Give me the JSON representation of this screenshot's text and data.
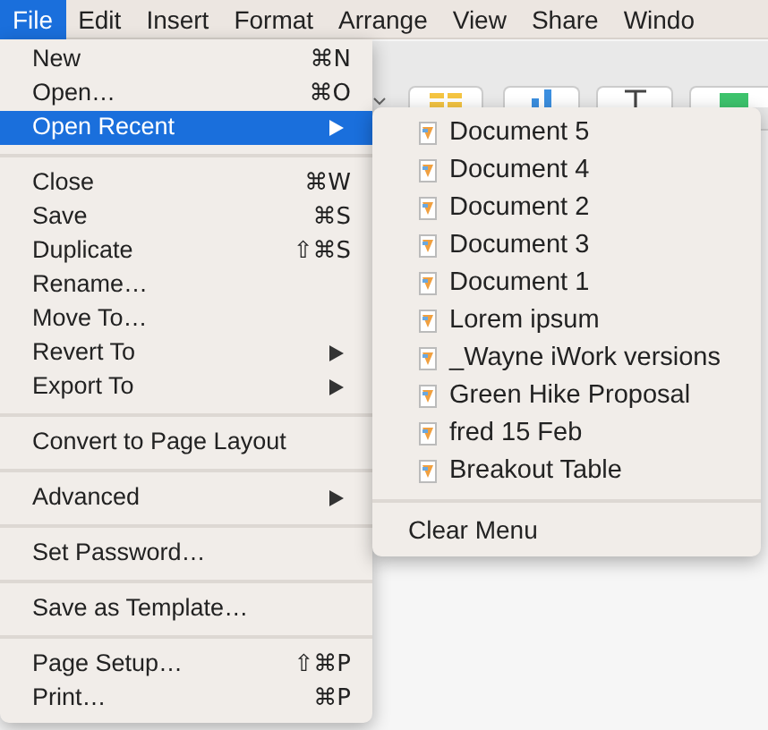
{
  "menubar": [
    {
      "label": "File",
      "selected": true
    },
    {
      "label": "Edit",
      "selected": false
    },
    {
      "label": "Insert",
      "selected": false
    },
    {
      "label": "Format",
      "selected": false
    },
    {
      "label": "Arrange",
      "selected": false
    },
    {
      "label": "View",
      "selected": false
    },
    {
      "label": "Share",
      "selected": false
    },
    {
      "label": "Windo",
      "selected": false
    }
  ],
  "file_menu": {
    "items": [
      {
        "kind": "item",
        "label": "New",
        "shortcut": "⌘N",
        "submenu": false,
        "selected": false
      },
      {
        "kind": "item",
        "label": "Open…",
        "shortcut": "⌘O",
        "submenu": false,
        "selected": false
      },
      {
        "kind": "item",
        "label": "Open Recent",
        "submenu": true,
        "selected": true
      },
      {
        "kind": "separator"
      },
      {
        "kind": "item",
        "label": "Close",
        "shortcut": "⌘W",
        "submenu": false,
        "selected": false
      },
      {
        "kind": "item",
        "label": "Save",
        "shortcut": "⌘S",
        "submenu": false,
        "selected": false
      },
      {
        "kind": "item",
        "label": "Duplicate",
        "shortcut": "⇧⌘S",
        "submenu": false,
        "selected": false
      },
      {
        "kind": "item",
        "label": "Rename…",
        "submenu": false,
        "selected": false
      },
      {
        "kind": "item",
        "label": "Move To…",
        "submenu": false,
        "selected": false
      },
      {
        "kind": "item",
        "label": "Revert To",
        "submenu": true,
        "selected": false
      },
      {
        "kind": "item",
        "label": "Export To",
        "submenu": true,
        "selected": false
      },
      {
        "kind": "separator"
      },
      {
        "kind": "item",
        "label": "Convert to Page Layout",
        "submenu": false,
        "selected": false
      },
      {
        "kind": "separator"
      },
      {
        "kind": "item",
        "label": "Advanced",
        "submenu": true,
        "selected": false
      },
      {
        "kind": "separator"
      },
      {
        "kind": "item",
        "label": "Set Password…",
        "submenu": false,
        "selected": false
      },
      {
        "kind": "separator"
      },
      {
        "kind": "item",
        "label": "Save as Template…",
        "submenu": false,
        "selected": false
      },
      {
        "kind": "separator"
      },
      {
        "kind": "item",
        "label": "Page Setup…",
        "shortcut": "⇧⌘P",
        "submenu": false,
        "selected": false
      },
      {
        "kind": "item",
        "label": "Print…",
        "shortcut": "⌘P",
        "submenu": false,
        "selected": false
      }
    ]
  },
  "open_recent_menu": {
    "items": [
      {
        "kind": "document",
        "label": "Document 5"
      },
      {
        "kind": "document",
        "label": "Document 4"
      },
      {
        "kind": "document",
        "label": "Document 2"
      },
      {
        "kind": "document",
        "label": "Document 3"
      },
      {
        "kind": "document",
        "label": "Document 1"
      },
      {
        "kind": "document",
        "label": "Lorem ipsum"
      },
      {
        "kind": "document",
        "label": "_Wayne iWork versions"
      },
      {
        "kind": "document",
        "label": "Green Hike Proposal"
      },
      {
        "kind": "document",
        "label": "fred 15 Feb"
      },
      {
        "kind": "document",
        "label": "Breakout Table"
      },
      {
        "kind": "separator"
      },
      {
        "kind": "command",
        "label": "Clear Menu"
      }
    ]
  }
}
